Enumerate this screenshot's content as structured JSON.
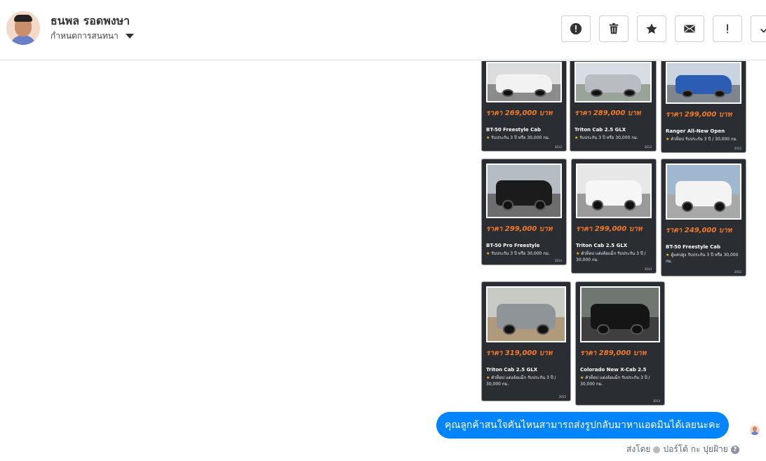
{
  "contact": {
    "name": "ธนพล รอดพงษา",
    "subtitle": "กำหนดการสนทนา"
  },
  "toolbar": {
    "buttons": [
      "alert-circle-icon",
      "trash-icon",
      "star-icon",
      "envelope-icon",
      "exclamation-icon",
      "check-icon"
    ]
  },
  "cards": [
    {
      "price": "ราคา 269,000 บาท",
      "model": "BT-50 Freestyle Cab",
      "feature": "รับประกัน 3 ปี หรือ 30,000 กม.",
      "year": "2012"
    },
    {
      "price": "ราคา 289,000 บาท",
      "model": "Triton Cab 2.5 GLX",
      "feature": "รับประกัน 3 ปี หรือ 30,000 กม.",
      "year": "2012"
    },
    {
      "price": "ราคา 299,000 บาท",
      "model": "Ranger All-New Open",
      "feature": "ตัวท็อป รับประกัน 3 ปี / 30,000 กม.",
      "year": "2012"
    },
    {
      "price": "ราคา 299,000 บาท",
      "model": "BT-50 Pro Freestyle",
      "feature": "รับประกัน 3 ปี หรือ 30,000 กม.",
      "year": "2013"
    },
    {
      "price": "ราคา 299,000 บาท",
      "model": "Triton Cab 2.5 GLX",
      "feature": "ตัวท็อป แต่งล้อแม็ก รับประกัน 3 ปี / 30,000 กม.",
      "year": "2014"
    },
    {
      "price": "ราคา 249,000 บาท",
      "model": "BT-50 Freestyle Cab",
      "feature": "ตู้แคปสูง รับประกัน 3 ปี หรือ 30,000 กม.",
      "year": "2012"
    },
    {
      "price": "ราคา 319,000 บาท",
      "model": "Triton Cab 2.5 GLX",
      "feature": "ตัวท็อป แต่งล้อแม็ก รับประกัน 3 ปี / 30,000 กม.",
      "year": "2015"
    },
    {
      "price": "ราคา 289,000 บาท",
      "model": "Colorado New X-Cab 2.5",
      "feature": "ตัวท็อป แต่งล้อแม็ก รับประกัน 3 ปี / 30,000 กม.",
      "year": "2013"
    }
  ],
  "message": {
    "text": "คุณลูกค้าสนใจคันไหนสามารถส่งรูปกลับมาหาแอดมินได้เลยนะคะ",
    "sent_by_label": "ส่งโดย",
    "sender": "ปอร์โต้ กะ ปุยฝ้าย",
    "help": "?"
  },
  "colors": {
    "bubble": "#0084ff",
    "price": "#f47a2a",
    "card_bg": "#2a2e33"
  }
}
